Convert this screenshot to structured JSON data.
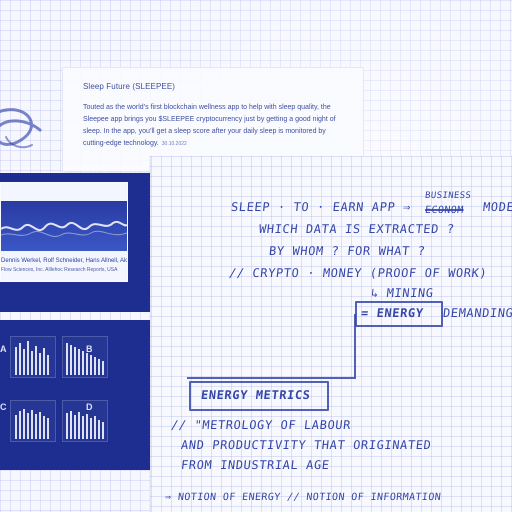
{
  "top_article": {
    "title": "Sleep Future (SLEEPEE)",
    "body": "Touted as the world’s first blockchain wellness app to help with sleep quality, the Sleepee app brings you $SLEEPEE cryptocurrency just by getting a good night of sleep. In the app, you’ll get a sleep score after your daily sleep is monitored by cutting-edge technology.",
    "small_note": "30.10.2022"
  },
  "panel_top": {
    "caption_line1": "Dennis Werkel, Rolf Schneider, Hans Allnell, Aloha Marie",
    "caption_line2": "Flow Sciences, Inc. Alllehoc Research Reports, USA"
  },
  "panel_bottom": {
    "labels": [
      "A",
      "B",
      "C",
      "D"
    ]
  },
  "notebook": {
    "line1_left": "SLEEP · TO · EARN APP ⇒",
    "line1_business": "BUSINESS",
    "line1_struck": "ECONOM",
    "line1_right": "MODEL",
    "line2": "WHICH DATA IS EXTRACTED ?",
    "line3": "BY WHOM ? FOR WHAT ?",
    "line4": "// CRYPTO · MONEY (PROOF OF WORK)",
    "line5": "↳ MINING",
    "box1": "= ENERGY",
    "line6_right": "DEMANDING",
    "box2": "ENERGY METRICS",
    "line7": "// \"METROLOGY OF LABOUR",
    "line8": "AND PRODUCTIVITY THAT ORIGINATED",
    "line9": "FROM INDUSTRIAL AGE",
    "line10": "⇒ NOTION OF ENERGY // NOTION OF INFORMATION"
  }
}
